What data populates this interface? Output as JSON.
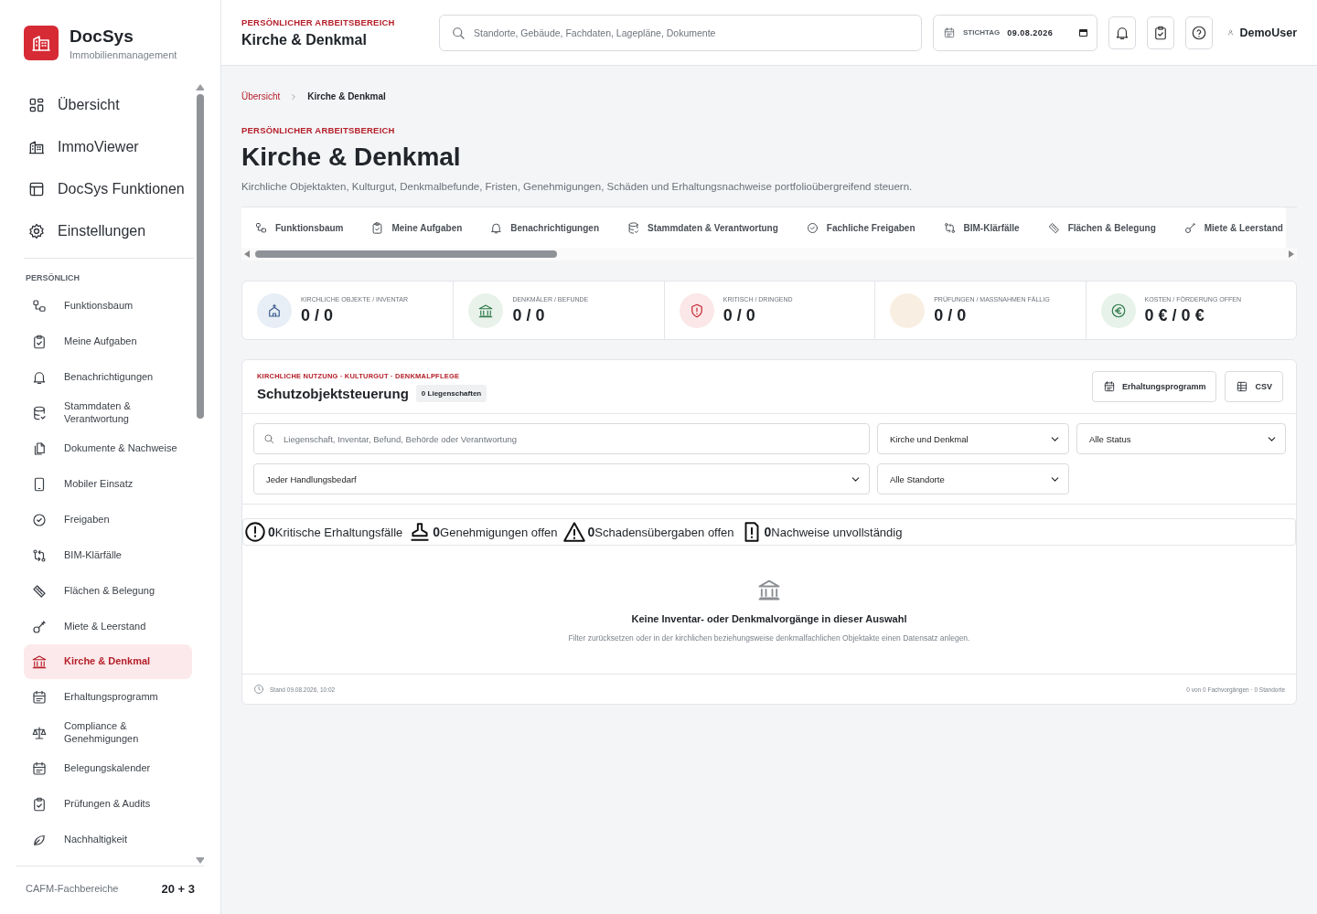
{
  "brand": {
    "name": "DocSys",
    "subtitle": "Immobilienmanagement"
  },
  "sidebar": {
    "main_items": [
      {
        "label": "Übersicht",
        "selected": false
      },
      {
        "label": "ImmoViewer",
        "selected": false
      },
      {
        "label": "DocSys Funktionen",
        "selected": false
      },
      {
        "label": "Einstellungen",
        "selected": false
      }
    ],
    "section_title": "PERSÖNLICH",
    "items": [
      {
        "label": "Funktionsbaum",
        "selected": false
      },
      {
        "label": "Meine Aufgaben",
        "selected": false
      },
      {
        "label": "Benachrichtigungen",
        "selected": false
      },
      {
        "label": "Stammdaten & Verantwortung",
        "selected": false
      },
      {
        "label": "Dokumente & Nachweise",
        "selected": false
      },
      {
        "label": "Mobiler Einsatz",
        "selected": false
      },
      {
        "label": "Freigaben",
        "selected": false
      },
      {
        "label": "BIM-Klärfälle",
        "selected": false
      },
      {
        "label": "Flächen & Belegung",
        "selected": false
      },
      {
        "label": "Miete & Leerstand",
        "selected": false
      },
      {
        "label": "Kirche & Denkmal",
        "selected": true
      },
      {
        "label": "Erhaltungsprogramm",
        "selected": false
      },
      {
        "label": "Compliance & Genehmigungen",
        "selected": false
      },
      {
        "label": "Belegungskalender",
        "selected": false
      },
      {
        "label": "Prüfungen & Audits",
        "selected": false
      },
      {
        "label": "Nachhaltigkeit",
        "selected": false
      }
    ],
    "footer": {
      "label": "CAFM-Fachbereiche",
      "count": "20 + 3"
    }
  },
  "header": {
    "eyebrow": "PERSÖNLICHER ARBEITSBEREICH",
    "title": "Kirche & Denkmal",
    "search": {
      "placeholder": "Standorte, Gebäude, Fachdaten, Lagepläne, Dokumente"
    },
    "date": {
      "label": "STICHTAG",
      "value": "09.08.2026"
    },
    "user": "DemoUser"
  },
  "breadcrumb": [
    {
      "label": "Übersicht"
    },
    {
      "label": "Kirche & Denkmal"
    }
  ],
  "page": {
    "eyebrow": "PERSÖNLICHER ARBEITSBEREICH",
    "title": "Kirche & Denkmal",
    "description": "Kirchliche Objektakten, Kulturgut, Denkmalbefunde, Fristen, Genehmigungen, Schäden und Erhaltungsnachweise portfolioübergreifend steuern."
  },
  "tabs": [
    {
      "label": "Funktionsbaum",
      "selected": false
    },
    {
      "label": "Meine Aufgaben",
      "selected": false
    },
    {
      "label": "Benachrichtigungen",
      "selected": false
    },
    {
      "label": "Stammdaten & Verantwortung",
      "selected": false
    },
    {
      "label": "Fachliche Freigaben",
      "selected": false
    },
    {
      "label": "BIM-Klärfälle",
      "selected": false
    },
    {
      "label": "Flächen & Belegung",
      "selected": false
    },
    {
      "label": "Miete & Leerstand",
      "selected": false
    }
  ],
  "kpis": [
    {
      "label": "KIRCHLICHE OBJEKTE / INVENTAR",
      "value": "0 / 0",
      "color": "#e8eef6"
    },
    {
      "label": "DENKMÄLER / BEFUNDE",
      "value": "0 / 0",
      "color": "#e8f2ea"
    },
    {
      "label": "KRITISCH / DRINGEND",
      "value": "0 / 0",
      "color": "#fbe7e8"
    },
    {
      "label": "PRÜFUNGEN / MASSNAHMEN FÄLLIG",
      "value": "0 / 0",
      "color": "#f8efe2"
    },
    {
      "label": "KOSTEN / FÖRDERUNG OFFEN",
      "value": "0 € / 0 €",
      "color": "#e6f2ea"
    }
  ],
  "panel": {
    "eyebrow": "KIRCHLICHE NUTZUNG · KULTURGUT · DENKMALPFLEGE",
    "title": "Schutzobjektsteuerung",
    "badge": "0 Liegenschaften",
    "buttons": [
      "Erhaltungsprogramm",
      "CSV"
    ],
    "search": {
      "placeholder": "Liegenschaft, Inventar, Befund, Behörde oder Verantwortung"
    },
    "filters": [
      {
        "value": "Kirche und Denkmal"
      },
      {
        "value": "Alle Status"
      },
      {
        "value": "Jeder Handlungsbedarf"
      },
      {
        "value": "Alle Standorte"
      }
    ],
    "summary": [
      {
        "count": "0",
        "label": "Kritische Erhaltungsfälle"
      },
      {
        "count": "0",
        "label": "Genehmigungen offen"
      },
      {
        "count": "0",
        "label": "Schadensübergaben offen"
      },
      {
        "count": "0",
        "label": "Nachweise unvollständig"
      }
    ],
    "empty": {
      "title": "Keine Inventar- oder Denkmalvorgänge in dieser Auswahl",
      "text": "Filter zurücksetzen oder in der kirchlichen beziehungsweise denkmalfachlichen Objektakte einen Datensatz anlegen."
    },
    "footer": {
      "timestamp": "Stand 09.08.2026, 10:02",
      "summary": "0 von 0 Fachvorgängen · 0 Standorte"
    }
  }
}
